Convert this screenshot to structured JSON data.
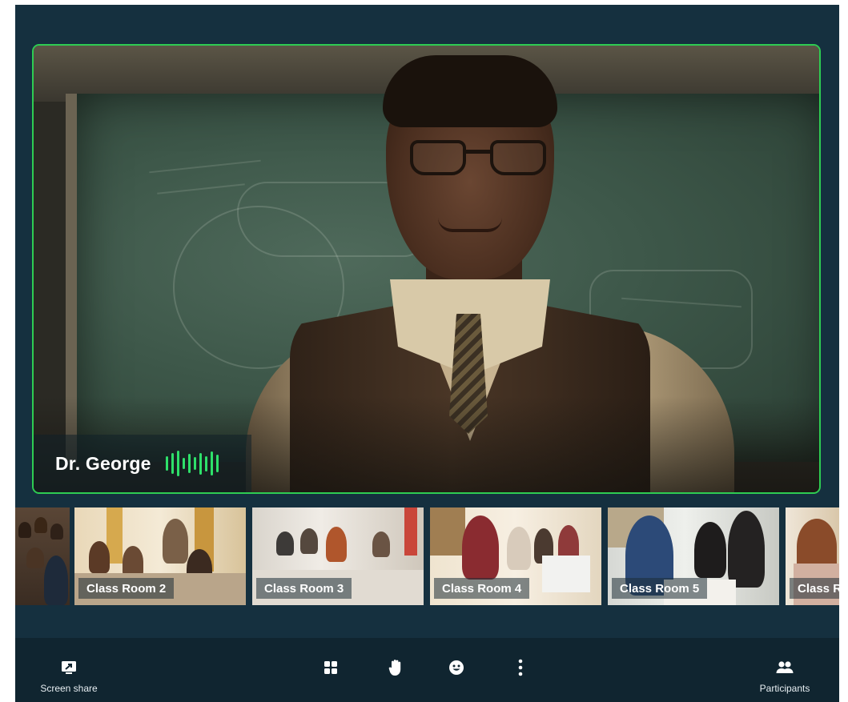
{
  "speaker": {
    "name": "Dr. George",
    "audio_bar_levels": [
      0.55,
      0.8,
      1.0,
      0.45,
      0.75,
      0.5,
      0.85,
      0.6,
      0.95,
      0.7
    ]
  },
  "rooms": [
    {
      "label": ""
    },
    {
      "label": "Class Room 2"
    },
    {
      "label": "Class Room 3"
    },
    {
      "label": "Class Room 4"
    },
    {
      "label": "Class Room 5"
    },
    {
      "label": "Class R"
    }
  ],
  "toolbar": {
    "screen_share": {
      "label": "Screen share",
      "icon": "screen-share-icon"
    },
    "grid": {
      "icon": "grid-view-icon"
    },
    "raise_hand": {
      "icon": "raise-hand-icon"
    },
    "reactions": {
      "icon": "emoji-icon"
    },
    "more": {
      "icon": "more-options-icon"
    },
    "participants": {
      "label": "Participants",
      "icon": "participants-icon"
    }
  },
  "colors": {
    "background": "#15303f",
    "toolbar": "#102530",
    "active_speaker_border": "#2ecc52",
    "audio_level": "#2ee06a"
  }
}
